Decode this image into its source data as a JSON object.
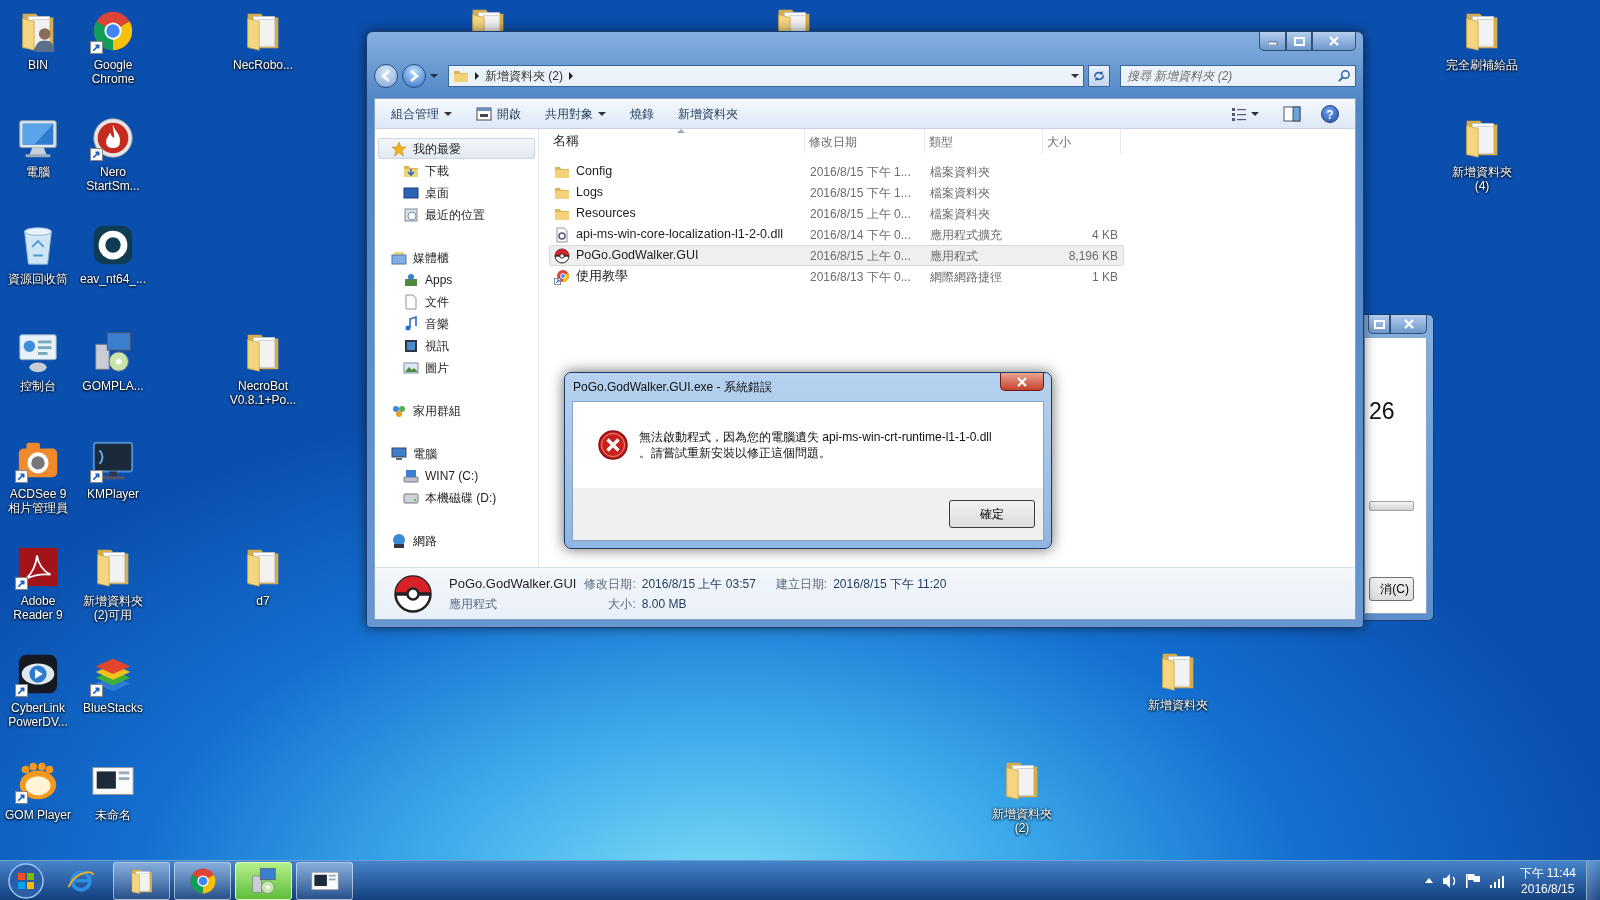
{
  "desktop_icons": [
    {
      "label": "BIN",
      "kind": "user-folder",
      "shortcut": false
    },
    {
      "label": "電腦",
      "kind": "computer",
      "shortcut": false
    },
    {
      "label": "資源回收筒",
      "kind": "recycle-bin",
      "shortcut": false
    },
    {
      "label": "控制台",
      "kind": "control-panel",
      "shortcut": false
    },
    {
      "label": "ACDSee 9 相片管理員",
      "kind": "camera",
      "shortcut": true
    },
    {
      "label": "Adobe Reader 9",
      "kind": "pdf",
      "shortcut": true
    },
    {
      "label": "CyberLink PowerDV...",
      "kind": "eye",
      "shortcut": true
    },
    {
      "label": "GOM Player",
      "kind": "gom",
      "shortcut": true
    },
    {
      "label": "Google Chrome",
      "kind": "chrome",
      "shortcut": true
    },
    {
      "label": "Nero StartSm...",
      "kind": "flame",
      "shortcut": true
    },
    {
      "label": "eav_nt64_...",
      "kind": "eset",
      "shortcut": false
    },
    {
      "label": "GOMPLA...",
      "kind": "installer",
      "shortcut": false
    },
    {
      "label": "KMPlayer",
      "kind": "monitor",
      "shortcut": true
    },
    {
      "label": "新增資料夾 (2)可用",
      "kind": "folder",
      "shortcut": false
    },
    {
      "label": "BlueStacks",
      "kind": "stack",
      "shortcut": true
    },
    {
      "label": "未命名",
      "kind": "screen",
      "shortcut": false
    },
    {
      "label": "NecRobo...",
      "kind": "folder",
      "shortcut": false
    },
    {
      "label": "NecroBot V0.8.1+Po...",
      "kind": "folder",
      "shortcut": false
    },
    {
      "label": "d7",
      "kind": "folder",
      "shortcut": false
    },
    {
      "kind": "folder",
      "shortcut": false
    },
    {
      "kind": "folder",
      "shortcut": false
    },
    {
      "label": "完全刷補給品",
      "kind": "folder",
      "shortcut": false
    },
    {
      "label": "新增資料夾 (4)",
      "kind": "folder",
      "shortcut": false
    },
    {
      "label": "新增資料夾",
      "kind": "folder",
      "shortcut": false
    },
    {
      "label": "新增資料夾 (2)",
      "kind": "folder",
      "shortcut": false
    }
  ],
  "explorer": {
    "address": {
      "path": [
        "新增資料夾 (2)"
      ]
    },
    "search": {
      "placeholder": "搜尋 新增資料夾 (2)"
    },
    "toolbar": [
      {
        "label": "組合管理",
        "kind": "plain",
        "dropdown": true
      },
      {
        "label": "開啟",
        "kind": "open",
        "dropdown": false
      },
      {
        "label": "共用對象",
        "kind": "plain",
        "dropdown": true
      },
      {
        "label": "燒錄",
        "kind": "plain",
        "dropdown": false
      },
      {
        "label": "新增資料夾",
        "kind": "plain",
        "dropdown": false
      }
    ],
    "help_label": "?",
    "nav": [
      {
        "label": "我的最愛",
        "kind": "star",
        "selected": true,
        "children": [
          {
            "label": "下載",
            "kind": "download",
            "selected": false
          },
          {
            "label": "桌面",
            "kind": "desktop",
            "selected": false
          },
          {
            "label": "最近的位置",
            "kind": "recent",
            "selected": false
          }
        ]
      },
      {
        "label": "媒體櫃",
        "kind": "library",
        "selected": false,
        "children": [
          {
            "label": "Apps",
            "kind": "apps",
            "selected": false
          },
          {
            "label": "文件",
            "kind": "doc",
            "selected": false
          },
          {
            "label": "音樂",
            "kind": "music",
            "selected": false
          },
          {
            "label": "視訊",
            "kind": "video",
            "selected": false
          },
          {
            "label": "圖片",
            "kind": "picture",
            "selected": false
          }
        ]
      },
      {
        "label": "家用群組",
        "kind": "homegroup",
        "selected": false
      },
      {
        "label": "電腦",
        "kind": "computer",
        "selected": false,
        "children": [
          {
            "label": "WIN7 (C:)",
            "kind": "drive-system",
            "selected": false
          },
          {
            "label": "本機磁碟 (D:)",
            "kind": "drive",
            "selected": false
          }
        ]
      },
      {
        "label": "網路",
        "kind": "network",
        "selected": false
      }
    ],
    "columns": [
      {
        "label": "名稱",
        "sorted": true
      },
      {
        "label": "修改日期",
        "sorted": false
      },
      {
        "label": "類型",
        "sorted": false
      },
      {
        "label": "大小",
        "sorted": false
      }
    ],
    "files": [
      {
        "name": "Config",
        "kind": "folder",
        "modified": "2016/8/15 下午 1...",
        "type": "檔案資料夾",
        "selected": false
      },
      {
        "name": "Logs",
        "kind": "folder",
        "modified": "2016/8/15 下午 1...",
        "type": "檔案資料夾",
        "selected": false
      },
      {
        "name": "Resources",
        "kind": "folder",
        "modified": "2016/8/15 上午 0...",
        "type": "檔案資料夾",
        "selected": false
      },
      {
        "name": "api-ms-win-core-localization-l1-2-0.dll",
        "kind": "dll",
        "modified": "2016/8/14 下午 0...",
        "type": "應用程式擴充",
        "size": "4 KB",
        "selected": false
      },
      {
        "name": "PoGo.GodWalker.GUI",
        "kind": "app",
        "modified": "2016/8/15 上午 0...",
        "type": "應用程式",
        "size": "8,196 KB",
        "selected": true
      },
      {
        "name": "使用教學",
        "kind": "web",
        "modified": "2016/8/13 下午 0...",
        "type": "網際網路捷徑",
        "size": "1 KB",
        "selected": false
      }
    ],
    "details": {
      "name": "PoGo.GodWalker.GUI",
      "type": "應用程式",
      "fields": [
        {
          "label": "修改日期:",
          "value": "2016/8/15 上午 03:57"
        },
        {
          "label": "建立日期:",
          "value": "2016/8/15 下午 11:20"
        },
        {
          "label": "大小:",
          "value": "8.00 MB"
        }
      ]
    }
  },
  "back_window": {
    "text": "26",
    "progress": {
      "level": 0
    },
    "button": "消(C)"
  },
  "dialog": {
    "title": "PoGo.GodWalker.GUI.exe - 系統錯誤",
    "message": "無法啟動程式，因為您的電腦遺失 api-ms-win-crt-runtime-l1-1-0.dll\n。請嘗試重新安裝以修正這個問題。",
    "button": "確定"
  },
  "taskbar": {
    "items": [
      {
        "kind": "ie",
        "running": false,
        "flashing": false
      },
      {
        "kind": "explorer",
        "running": true,
        "flashing": false
      },
      {
        "kind": "chrome",
        "running": true,
        "flashing": false
      },
      {
        "kind": "installer",
        "running": true,
        "flashing": true
      },
      {
        "kind": "screen",
        "running": true,
        "flashing": false
      }
    ],
    "time": "下午 11:44",
    "date": "2016/8/15"
  }
}
